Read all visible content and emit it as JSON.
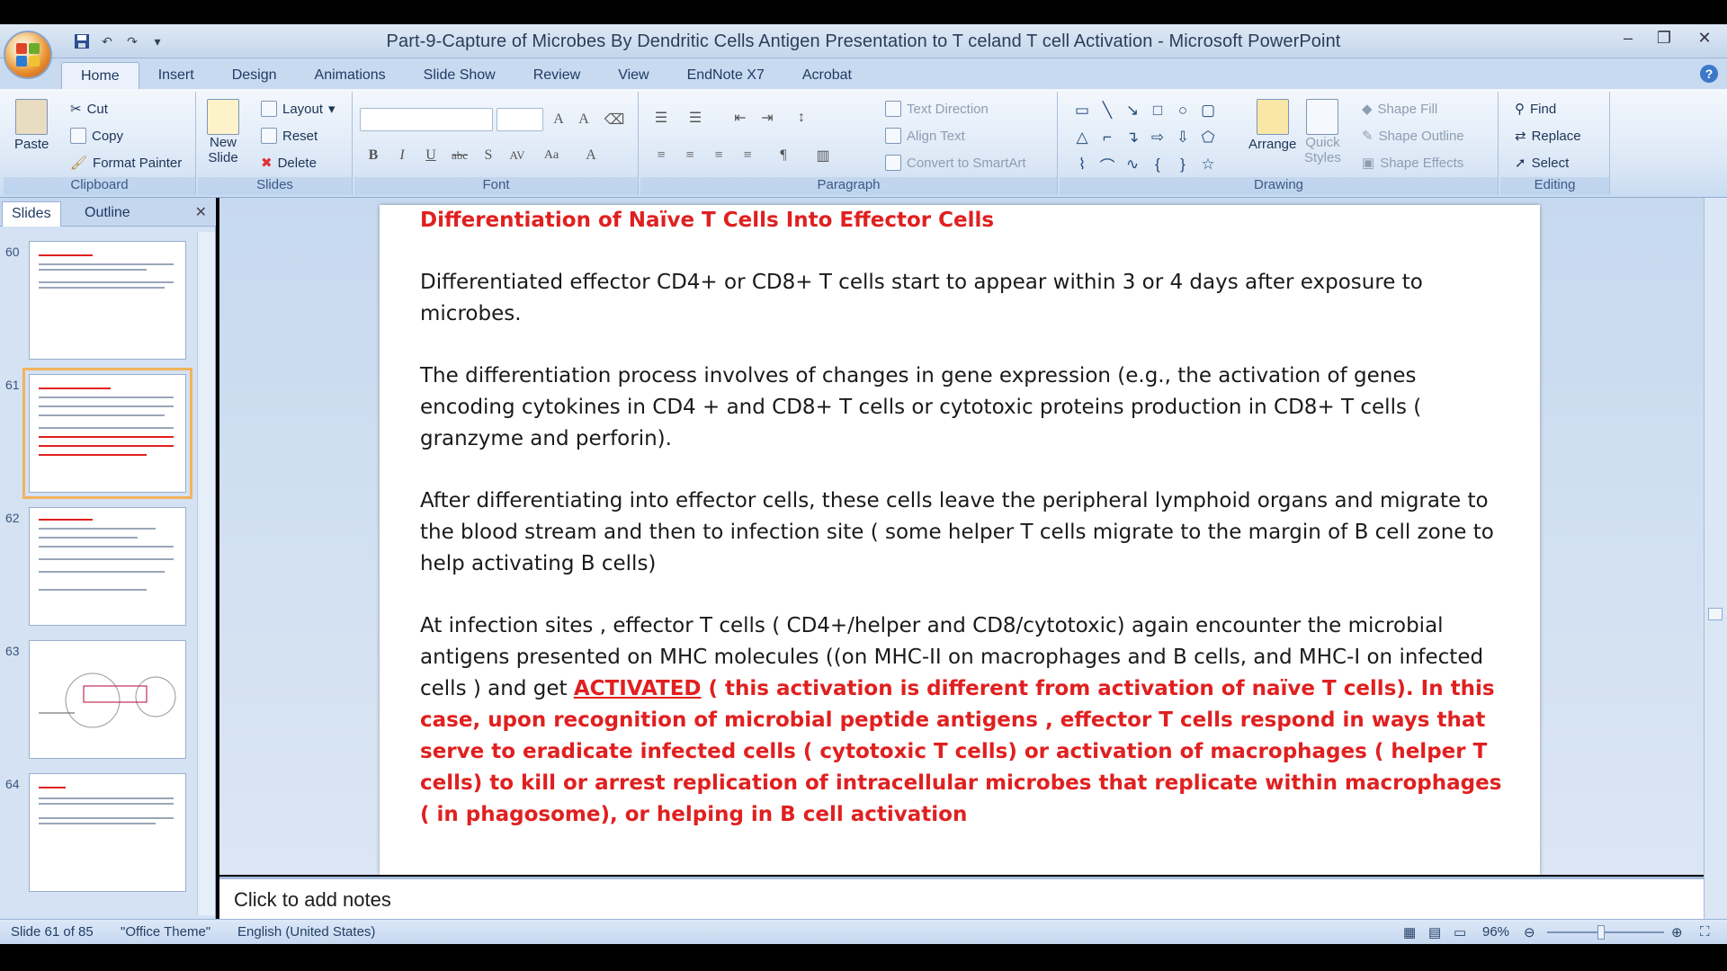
{
  "window": {
    "title": "Part-9-Capture of Microbes By Dendritic Cells  Antigen Presentation to T celand T cell Activation - Microsoft PowerPoint"
  },
  "tabs": [
    "Home",
    "Insert",
    "Design",
    "Animations",
    "Slide Show",
    "Review",
    "View",
    "EndNote X7",
    "Acrobat"
  ],
  "ribbon": {
    "clipboard": {
      "paste": "Paste",
      "cut": "Cut",
      "copy": "Copy",
      "format_painter": "Format Painter",
      "label": "Clipboard"
    },
    "slides": {
      "new_slide": "New",
      "new_slide2": "Slide",
      "layout": "Layout",
      "reset": "Reset",
      "delete": "Delete",
      "label": "Slides"
    },
    "font": {
      "label": "Font"
    },
    "paragraph": {
      "text_direction": "Text Direction",
      "align_text": "Align Text",
      "convert_smartart": "Convert to SmartArt",
      "label": "Paragraph"
    },
    "drawing": {
      "arrange": "Arrange",
      "quick_styles": "Quick",
      "quick_styles2": "Styles",
      "shape_fill": "Shape Fill",
      "shape_outline": "Shape Outline",
      "shape_effects": "Shape Effects",
      "label": "Drawing"
    },
    "editing": {
      "find": "Find",
      "replace": "Replace",
      "select": "Select",
      "label": "Editing"
    }
  },
  "left_panel": {
    "tab_slides": "Slides",
    "tab_outline": "Outline",
    "thumbnails": [
      "60",
      "61",
      "62",
      "63",
      "64"
    ]
  },
  "slide": {
    "title": "Differentiation of Naïve T Cells Into Effector  Cells",
    "p1": "Differentiated effector  CD4+ or CD8+ T cells  start to appear within 3 or 4 days after exposure to microbes.",
    "p2": "The differentiation  process involves of changes in gene expression (e.g.,  the activation of genes encoding cytokines  in  CD4 + and CD8+ T cells or cytotoxic proteins production in CD8+  T cells ( granzyme  and perforin).",
    "p3": "After differentiating into effector cells, these cells leave the peripheral lymphoid organs and migrate to the blood stream and then to infection site ( some helper T cells migrate to the margin of B cell zone to help activating  B cells)",
    "p4_start": " At infection sites , effector  T cells ( CD4+/helper and  CD8/cytotoxic) again encounter the microbial antigens presented on MHC  molecules ((on MHC-II on macrophages and B cells, and MHC-I  on infected cells ) and get ",
    "p4_activated": "ACTIVATED",
    "p4_red": " ( this activation is different from activation of  naïve T cells).  In this case,  upon recognition  of microbial peptide antigens , effector  T cells  respond in ways that serve to eradicate  infected cells ( cytotoxic T cells) or activation of macrophages ( helper T cells) to kill or arrest replication of  intracellular  microbes that replicate within macrophages ( in phagosome), or helping in B cell  activation"
  },
  "notes": {
    "placeholder": "Click to add notes"
  },
  "status": {
    "slide_of": "Slide 61 of 85",
    "theme": "\"Office Theme\"",
    "language": "English (United States)",
    "zoom": "96%"
  },
  "colors": {
    "accent_red": "#e02020",
    "selection": "#f2b35c",
    "ribbon_blue": "#c8daf0"
  }
}
